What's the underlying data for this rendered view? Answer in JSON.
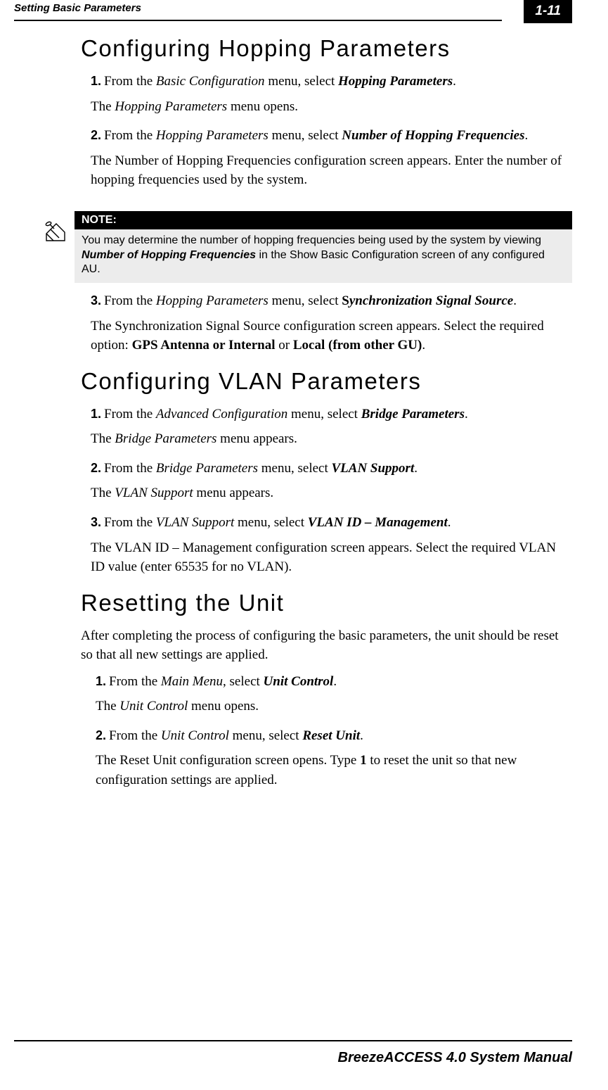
{
  "header": {
    "section_title": "Setting Basic Parameters",
    "page_number": "1-11"
  },
  "sections": {
    "hopping": {
      "heading": "Configuring Hopping Parameters",
      "step1_num": "1.",
      "step1_a": "From the ",
      "step1_b": "Basic Configuration",
      "step1_c": " menu, select ",
      "step1_d": "Hopping Parameters",
      "step1_e": ".",
      "step1_sub_a": "The ",
      "step1_sub_b": "Hopping Parameters",
      "step1_sub_c": " menu opens.",
      "step2_num": "2.",
      "step2_a": "From the ",
      "step2_b": "Hopping Parameters",
      "step2_c": " menu, select ",
      "step2_d": "Number of Hopping Frequencies",
      "step2_e": ".",
      "step2_sub": "The Number of Hopping Frequencies configuration screen appears. Enter the number of hopping frequencies used by the system.",
      "step3_num": "3.",
      "step3_a": "From the ",
      "step3_b": "Hopping Parameters",
      "step3_c": " menu, select ",
      "step3_d_bold": "S",
      "step3_d_rest": "ynchronization Signal Source",
      "step3_e": ".",
      "step3_sub_a": "The Synchronization Signal Source configuration screen appears. Select the required option: ",
      "step3_sub_b": "GPS Antenna or Internal",
      "step3_sub_c": " or ",
      "step3_sub_d": "Local (from other GU)",
      "step3_sub_e": "."
    },
    "note": {
      "label": "NOTE:",
      "body_a": "You may determine the number of hopping frequencies being used by the system by viewing ",
      "body_b": "Number of Hopping Frequencies",
      "body_c": " in the Show Basic Configuration screen of any configured AU."
    },
    "vlan": {
      "heading": "Configuring VLAN Parameters",
      "step1_num": "1.",
      "step1_a": "From the ",
      "step1_b": "Advanced Configuration",
      "step1_c": " menu, select ",
      "step1_d": "Bridge Parameters",
      "step1_e": ".",
      "step1_sub_a": "The ",
      "step1_sub_b": "Bridge Parameters",
      "step1_sub_c": " menu appears.",
      "step2_num": "2.",
      "step2_a": "From the ",
      "step2_b": "Bridge Parameters",
      "step2_c": " menu, select ",
      "step2_d": "VLAN Support",
      "step2_e": ".",
      "step2_sub_a": "The ",
      "step2_sub_b": "VLAN Support",
      "step2_sub_c": " menu appears.",
      "step3_num": "3.",
      "step3_a": "From the ",
      "step3_b": "VLAN Support",
      "step3_c": " menu, select ",
      "step3_d": "VLAN ID – Management",
      "step3_e": ".",
      "step3_sub": "The VLAN ID – Management configuration screen appears. Select the required VLAN ID value (enter 65535 for no VLAN)."
    },
    "reset": {
      "heading": "Resetting the Unit",
      "intro": "After completing the process of configuring the basic parameters, the unit should be reset so that all new settings are applied.",
      "step1_num": "1.",
      "step1_a": "From the ",
      "step1_b": "Main Menu",
      "step1_c": ", select ",
      "step1_d": "Unit Control",
      "step1_e": ".",
      "step1_sub_a": "The ",
      "step1_sub_b": "Unit Control",
      "step1_sub_c": " menu opens.",
      "step2_num": "2.",
      "step2_a": "From the ",
      "step2_b": "Unit Control",
      "step2_c": " menu, select ",
      "step2_d": "Reset Unit",
      "step2_e": ".",
      "step2_sub_a": "The Reset Unit configuration screen opens. Type ",
      "step2_sub_b": "1",
      "step2_sub_c": " to reset the unit so that new configuration settings are applied."
    }
  },
  "footer": {
    "text": "BreezeACCESS 4.0 System Manual"
  }
}
